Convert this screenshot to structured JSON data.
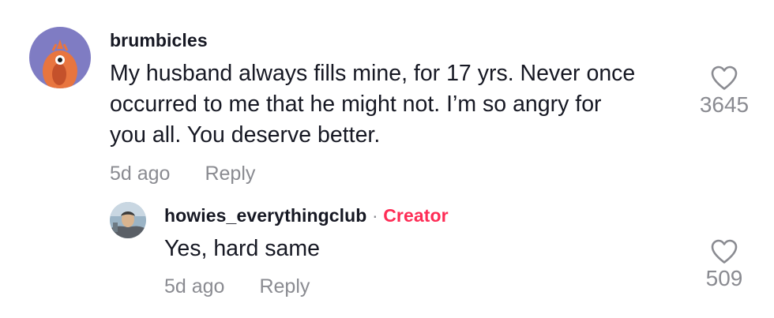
{
  "comments": [
    {
      "username": "brumbicles",
      "text": "My husband always fills mine, for 17 yrs. Never once occurred to me that he might not. I’m so angry for you all. You deserve better.",
      "time": "5d ago",
      "reply_label": "Reply",
      "likes": "3645",
      "avatar_color": "#7f7cc3"
    }
  ],
  "replies": [
    {
      "username": "howies_everythingclub",
      "separator": "·",
      "badge": "Creator",
      "text": "Yes, hard same",
      "time": "5d ago",
      "reply_label": "Reply",
      "likes": "509"
    }
  ],
  "icons": {
    "like": "heart-outline-icon"
  },
  "colors": {
    "text": "#161823",
    "secondary": "#8a8b91",
    "creator": "#fe2c55"
  }
}
